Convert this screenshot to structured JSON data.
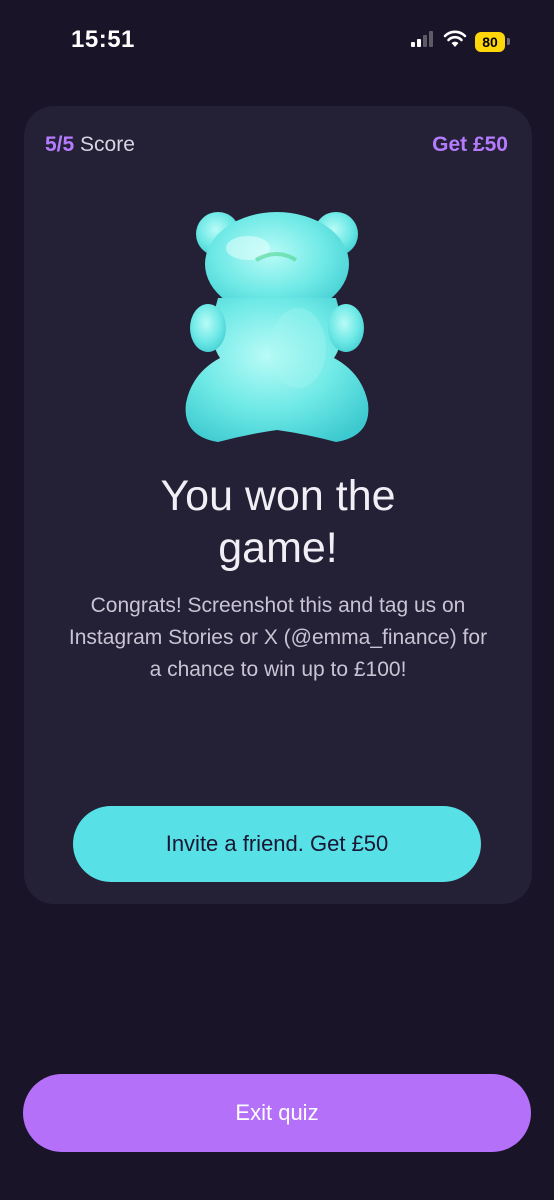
{
  "status_bar": {
    "time": "15:51",
    "battery_level": "80",
    "icons": [
      "signal-icon",
      "wifi-icon",
      "battery-icon"
    ],
    "battery_color": "#ffd60a"
  },
  "card": {
    "score_value": "5/5",
    "score_label": "Score",
    "reward_label": "Get £50",
    "image": "gummy-bear-icon",
    "headline_line1": "You won the",
    "headline_line2": "game!",
    "message": "Congrats! Screenshot this and tag us on Instagram Stories or X (@emma_finance) for a chance to win up to £100!",
    "invite_button_label": "Invite a friend. Get £50"
  },
  "footer": {
    "exit_button_label": "Exit quiz"
  },
  "colors": {
    "background": "#191428",
    "card": "#242035",
    "accent_purple": "#b57bff",
    "accent_cyan": "#57e0e6",
    "exit_button": "#b570fa"
  }
}
